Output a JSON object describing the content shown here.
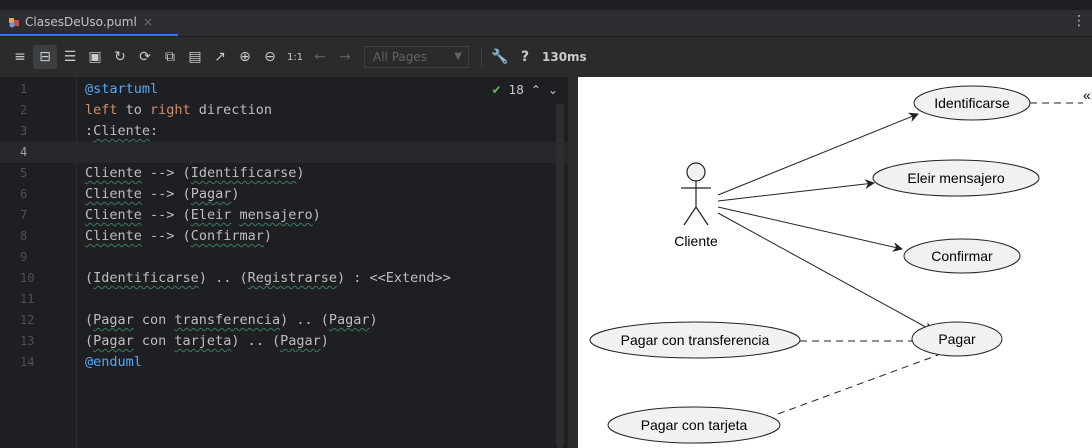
{
  "tab": {
    "filename": "ClasesDeUso.puml",
    "close_glyph": "×",
    "icon": "plantuml-file-icon"
  },
  "window": {
    "menu_glyph": "⋮"
  },
  "toolbar": {
    "pages_dropdown": "All Pages",
    "zoom_label": "1:1",
    "help_label": "?",
    "timing": "130ms"
  },
  "editor": {
    "inspections_count": "18",
    "lines": [
      {
        "n": "1",
        "text": "@startuml"
      },
      {
        "n": "2",
        "text": "left to right direction"
      },
      {
        "n": "3",
        "text": ":Cliente:"
      },
      {
        "n": "4",
        "text": ""
      },
      {
        "n": "5",
        "text": "Cliente --> (Identificarse)"
      },
      {
        "n": "6",
        "text": "Cliente --> (Pagar)"
      },
      {
        "n": "7",
        "text": "Cliente --> (Eleir mensajero)"
      },
      {
        "n": "8",
        "text": "Cliente --> (Confirmar)"
      },
      {
        "n": "9",
        "text": ""
      },
      {
        "n": "10",
        "text": "(Identificarse) .. (Registrarse) : <<Extend>>"
      },
      {
        "n": "11",
        "text": ""
      },
      {
        "n": "12",
        "text": "(Pagar con transferencia) .. (Pagar)"
      },
      {
        "n": "13",
        "text": "(Pagar con tarjeta) .. (Pagar)"
      },
      {
        "n": "14",
        "text": "@enduml"
      }
    ]
  },
  "diagram": {
    "actor": "Cliente",
    "usecases": {
      "identificarse": "Identificarse",
      "eleir": "Eleir mensajero",
      "confirmar": "Confirmar",
      "pagar": "Pagar",
      "transferencia": "Pagar con transferencia",
      "tarjeta": "Pagar con tarjeta"
    },
    "extend_label": "«E"
  },
  "colors": {
    "accent": "#3574f0",
    "keyword": "#cf8e6d",
    "annotation": "#56a8f5",
    "usecase_fill": "#f1f1f1"
  }
}
